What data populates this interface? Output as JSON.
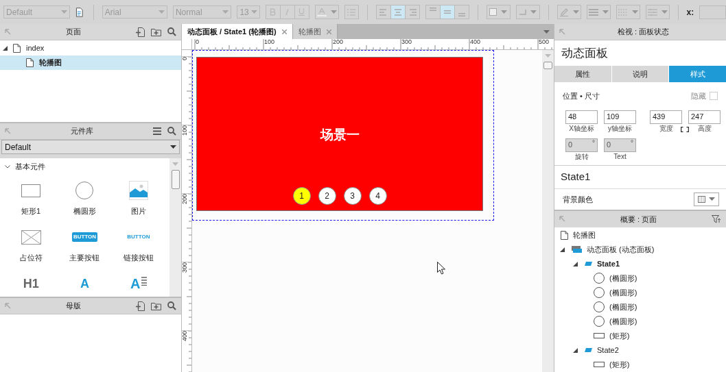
{
  "toolbar": {
    "style": "Default",
    "font": "Arial",
    "weight": "Normal",
    "size": "13",
    "h_align": [
      {
        "kind": "left",
        "selected": false
      },
      {
        "kind": "center",
        "selected": true
      },
      {
        "kind": "right",
        "selected": false
      }
    ],
    "v_align": [
      {
        "kind": "top",
        "selected": false
      },
      {
        "kind": "middle",
        "selected": true
      },
      {
        "kind": "bottom",
        "selected": false
      }
    ],
    "x_label": "x:"
  },
  "pages_panel": {
    "title": "页面",
    "tree": [
      {
        "label": "index",
        "expanded": true,
        "selected": false,
        "children": [
          {
            "label": "轮播图",
            "selected": true
          }
        ]
      }
    ]
  },
  "library_panel": {
    "title": "元件库",
    "library": "Default",
    "group": {
      "label": "基本元件",
      "expanded": true
    },
    "widgets": [
      {
        "kind": "rectangle",
        "label": "矩形1"
      },
      {
        "kind": "ellipse",
        "label": "椭圆形"
      },
      {
        "kind": "image",
        "label": "图片"
      },
      {
        "kind": "placeholder",
        "label": "占位符"
      },
      {
        "kind": "primary_button",
        "label": "主要按钮",
        "glyph": "BUTTON"
      },
      {
        "kind": "link_button",
        "label": "链接按钮",
        "glyph": "BUTTON"
      },
      {
        "kind": "heading",
        "glyph": "H1"
      },
      {
        "kind": "heading_blue",
        "glyph": "A"
      },
      {
        "kind": "paragraph",
        "glyph": "A"
      }
    ]
  },
  "masters_panel": {
    "title": "母版"
  },
  "tabs": [
    {
      "label": "动态面板 / State1 (轮播图)",
      "selected": true
    },
    {
      "label": "轮播图",
      "selected": false
    }
  ],
  "rulers": {
    "horizontal": [
      "0",
      "100",
      "200",
      "300",
      "400",
      "500"
    ],
    "vertical": [
      "0",
      "100",
      "200",
      "300",
      "400"
    ]
  },
  "canvas": {
    "panel_text": "场景一",
    "dots": [
      {
        "label": "1",
        "selected": true
      },
      {
        "label": "2",
        "selected": false
      },
      {
        "label": "3",
        "selected": false
      },
      {
        "label": "4",
        "selected": false
      }
    ]
  },
  "inspector": {
    "title": "检视 : 面板状态",
    "name": "动态面板",
    "tabs": [
      {
        "label": "属性",
        "selected": false
      },
      {
        "label": "说明",
        "selected": false
      },
      {
        "label": "样式",
        "selected": true
      }
    ],
    "section": "位置 • 尺寸",
    "hidden": {
      "label": "隐藏",
      "checked": false
    },
    "fields": [
      {
        "value": "48",
        "label": "X轴坐标"
      },
      {
        "value": "109",
        "label": "y轴坐标"
      },
      {
        "value": "439",
        "label": "宽度"
      },
      {
        "value": "247",
        "label": "高度"
      }
    ],
    "rotation_fields": [
      {
        "value": "0",
        "unit": "°",
        "label": "旋转",
        "disabled": true
      },
      {
        "value": "0",
        "unit": "°",
        "label": "Text",
        "disabled": true
      }
    ],
    "state_name": "State1",
    "background_label": "背景颜色"
  },
  "outline_panel": {
    "title": "概要 : 页面",
    "tree": [
      {
        "kind": "page",
        "label": "轮播图"
      },
      {
        "kind": "dynamic_panel",
        "label": "动态面板 (动态面板)",
        "expanded": true,
        "children": [
          {
            "kind": "state",
            "label": "State1",
            "expanded": true,
            "selected": true,
            "children": [
              {
                "kind": "ellipse",
                "label": "(椭圆形)"
              },
              {
                "kind": "ellipse",
                "label": "(椭圆形)"
              },
              {
                "kind": "ellipse",
                "label": "(椭圆形)"
              },
              {
                "kind": "ellipse",
                "label": "(椭圆形)"
              },
              {
                "kind": "rectangle",
                "label": "(矩形)"
              }
            ]
          },
          {
            "kind": "state",
            "label": "State2",
            "expanded": true,
            "selected": false,
            "children": [
              {
                "kind": "rectangle",
                "label": "(矩形)"
              }
            ]
          }
        ]
      }
    ]
  }
}
